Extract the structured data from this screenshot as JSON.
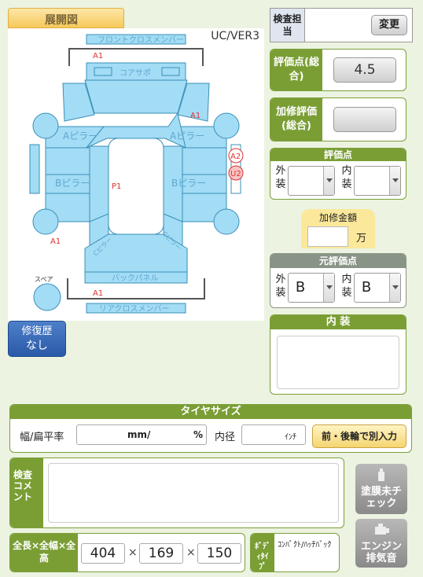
{
  "diagram": {
    "tab_title": "展開図",
    "version": "UC/VER3",
    "parts": {
      "front_cross_member": "フロントクロスメンバー",
      "core_support": "コアサポ",
      "a_pillar_left": "Aピラー",
      "a_pillar_right": "Aピラー",
      "b_pillar_left": "Bピラー",
      "b_pillar_right": "Bピラー",
      "c_pillar_left": "Cピラー",
      "c_pillar_right": "Cピラー",
      "back_panel": "バックパネル",
      "rear_cross_member": "リアクロスメンバー",
      "spare": "スペア"
    },
    "marks": {
      "top_a1": "A1",
      "right_a1": "A1",
      "p1": "P1",
      "left_a1": "A1",
      "bottom_a1": "A1",
      "a2": "A2",
      "u2": "U2"
    }
  },
  "repair_history": {
    "label": "修復歴",
    "value": "なし"
  },
  "inspector": {
    "label": "検査担当",
    "change_button": "変更"
  },
  "evaluation_total": {
    "label": "評価点(総合)",
    "value": "4.5"
  },
  "fix_evaluation": {
    "label": "加修評価(総合)",
    "value": ""
  },
  "evaluation_score": {
    "header": "評価点",
    "exterior_label": "外装",
    "interior_label": "内装",
    "exterior_value": "",
    "interior_value": ""
  },
  "fix_amount": {
    "label": "加修金額",
    "value": "",
    "unit": "万"
  },
  "original_score": {
    "header": "元評価点",
    "exterior_label": "外装",
    "interior_label": "内装",
    "exterior_value": "B",
    "interior_value": "B"
  },
  "interior": {
    "header": "内 装",
    "value": ""
  },
  "tire": {
    "header": "タイヤサイズ",
    "width_label": "幅/扁平率",
    "mm_unit": "mm/",
    "percent_unit": "%",
    "diameter_label": "内径",
    "inch_unit": "ｲﾝﾁ",
    "front_rear_button": "前・後輪で別入力"
  },
  "comment": {
    "label": "検査コメント",
    "value": ""
  },
  "buttons": {
    "paint": "塗膜未チェック",
    "engine": "エンジン排気音"
  },
  "dimensions": {
    "label": "全長×全幅×全高",
    "length": "404",
    "width": "169",
    "height": "150",
    "separator": "×"
  },
  "body_type": {
    "label": "ﾎﾞﾃﾞｨﾀｲﾌﾟ",
    "value": "ｺﾝﾊﾟｸﾄ/ﾊｯﾁﾊﾞｯｸ"
  },
  "colors": {
    "accent_green": "#7a9e34",
    "part_blue": "#a3dcf5",
    "mark_red": "#e03030"
  }
}
